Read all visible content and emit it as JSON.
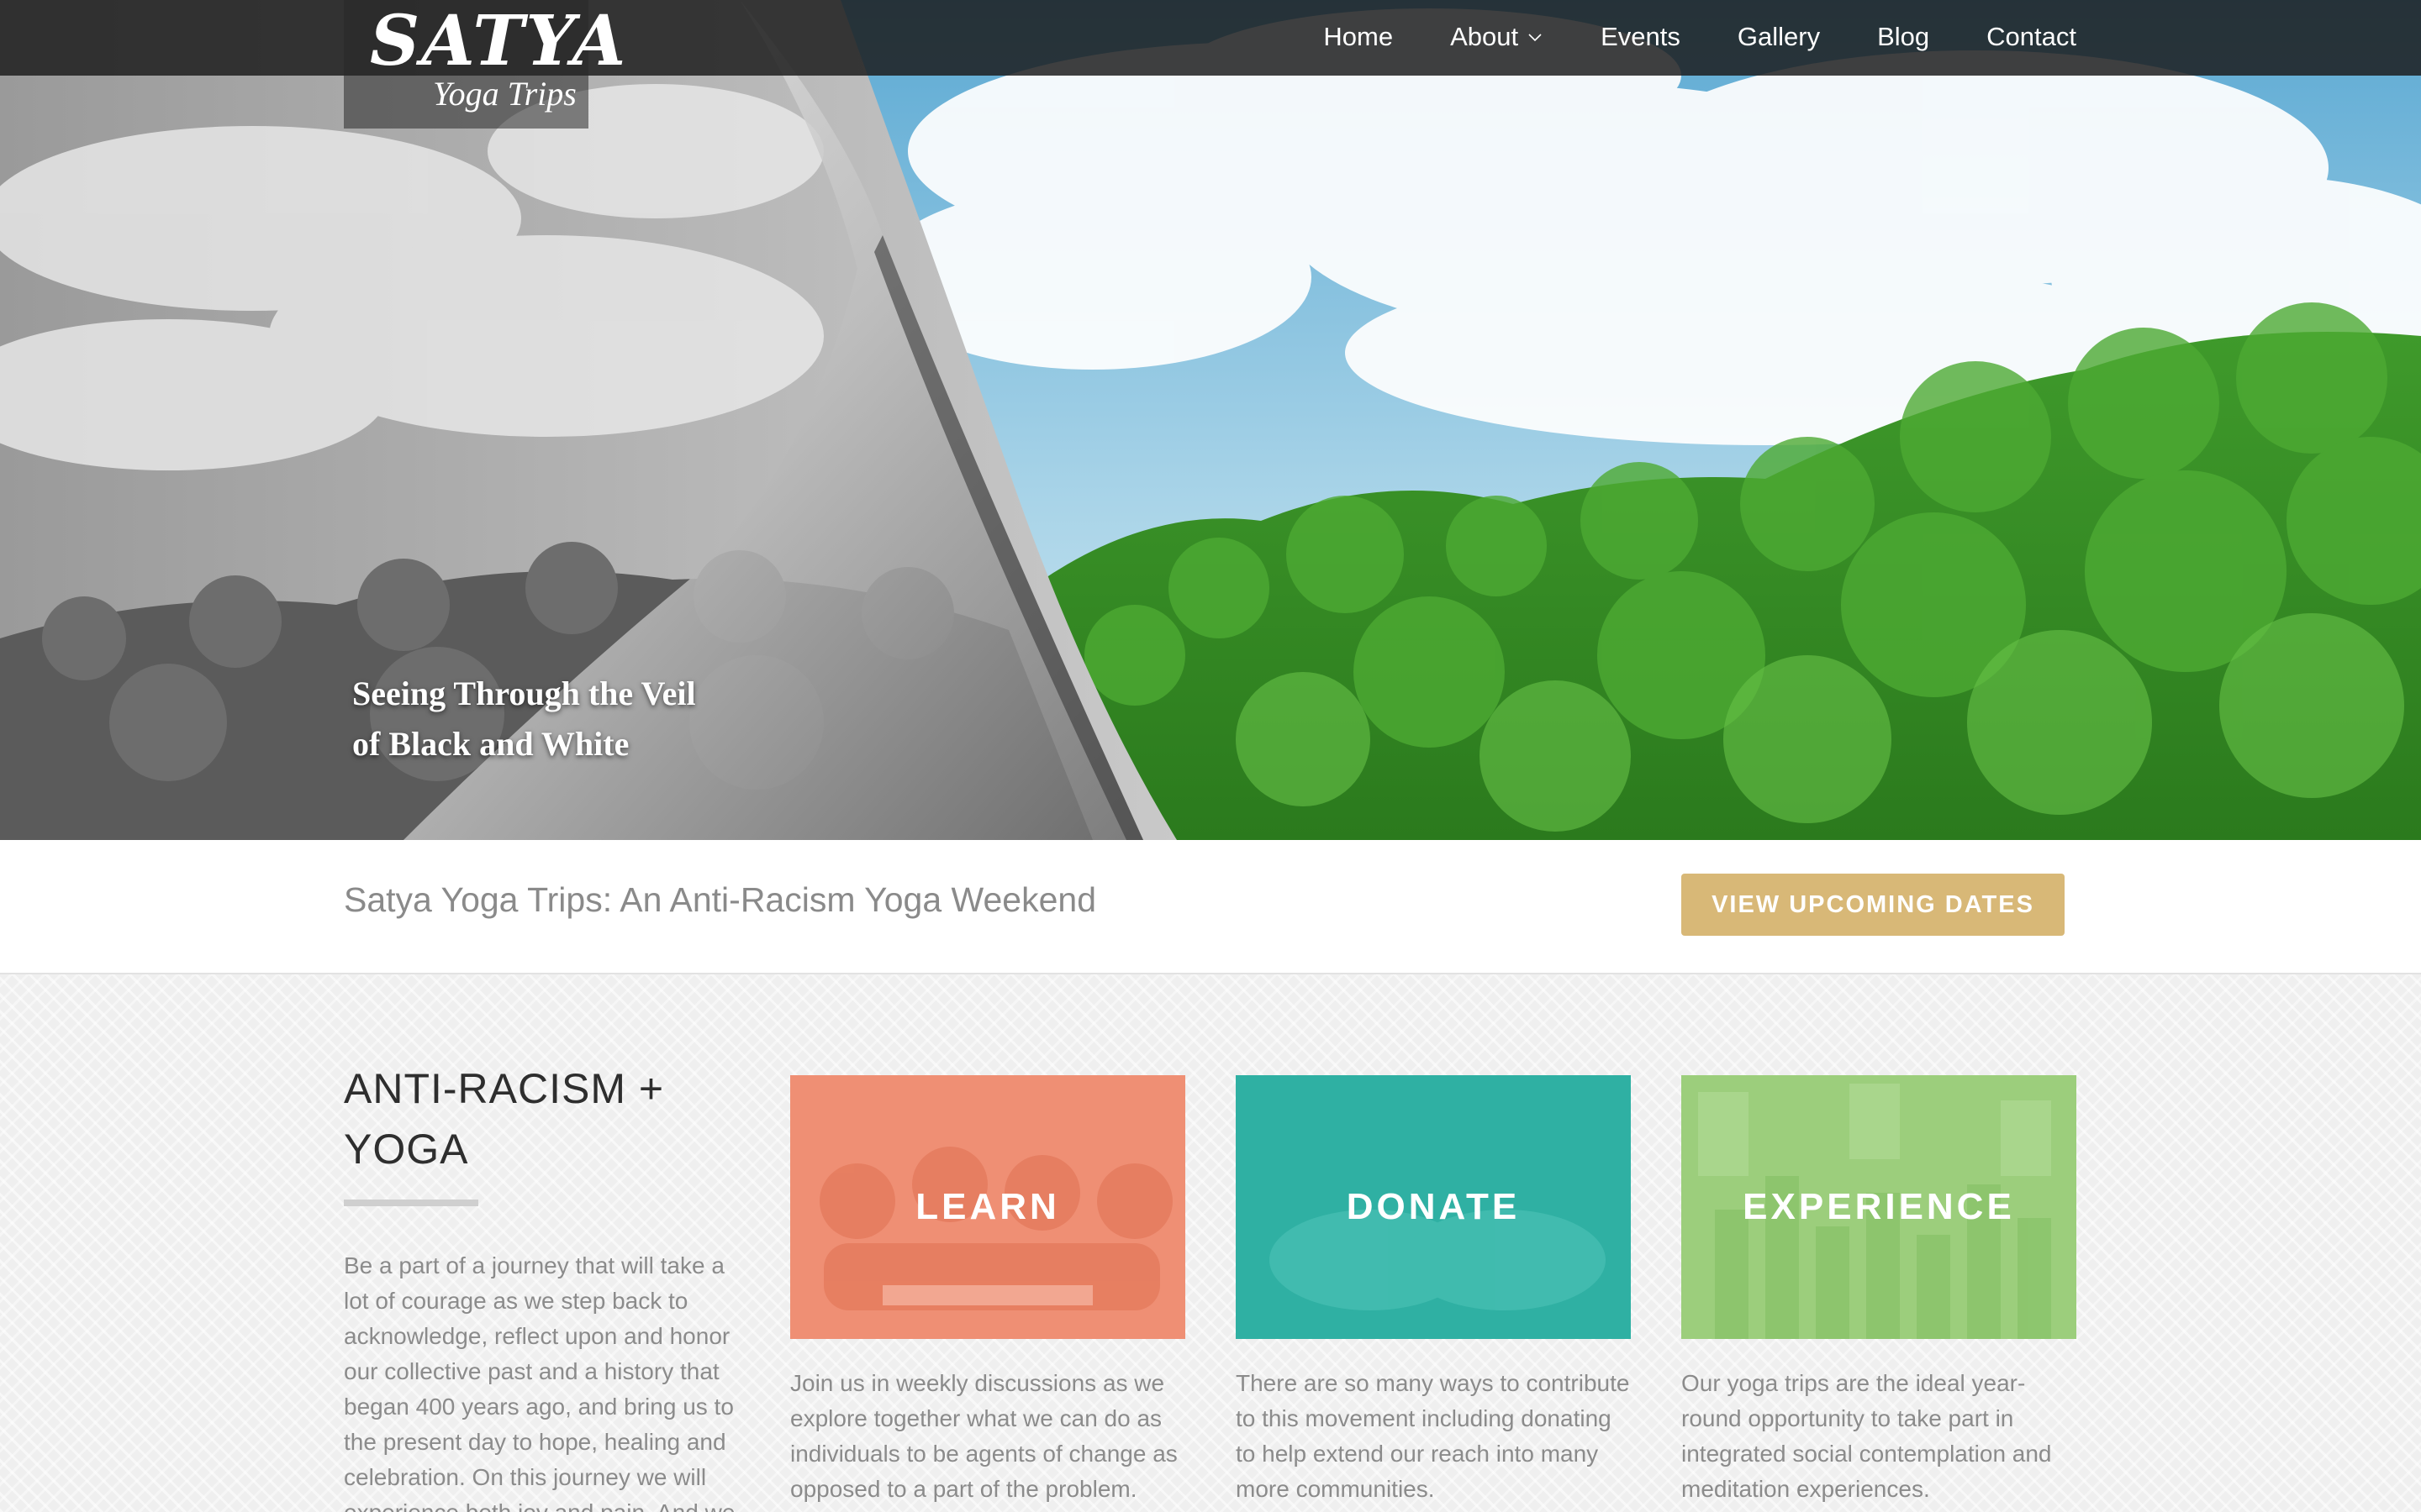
{
  "logo": {
    "title": "SATYA",
    "subtitle": "Yoga Trips"
  },
  "nav": {
    "items": [
      {
        "label": "Home"
      },
      {
        "label": "About"
      },
      {
        "label": "Events"
      },
      {
        "label": "Gallery"
      },
      {
        "label": "Blog"
      },
      {
        "label": "Contact"
      }
    ]
  },
  "hero": {
    "caption_line1": "Seeing Through the Veil",
    "caption_line2": "of Black and White"
  },
  "banner": {
    "text": "Satya Yoga Trips: An Anti-Racism Yoga Weekend",
    "cta_label": "VIEW UPCOMING DATES"
  },
  "intro": {
    "title": "ANTI-RACISM + YOGA",
    "text": "Be a part of a journey that will take a lot of courage as we step back to acknowledge, reflect upon and honor our collective past and a history that began 400 years ago, and bring us to the present day to hope, healing and celebration. On this journey we will experience both joy and pain. And we"
  },
  "cards": [
    {
      "label": "LEARN",
      "desc": "Join us in weekly discussions as we explore together what we can do as individuals to be agents of change as opposed to a part of the problem.",
      "color": "#ef8f74"
    },
    {
      "label": "DONATE",
      "desc": "There are so many ways to contribute to this movement including donating to help extend our reach into many more communities.",
      "color": "#2fb0a3"
    },
    {
      "label": "EXPERIENCE",
      "desc": "Our yoga trips are the ideal year-round opportunity to take part in integrated social contemplation and meditation experiences.",
      "color": "#9cce7c"
    }
  ],
  "colors": {
    "accent": "#d8b877",
    "nav_bg": "#1c1c1c"
  }
}
